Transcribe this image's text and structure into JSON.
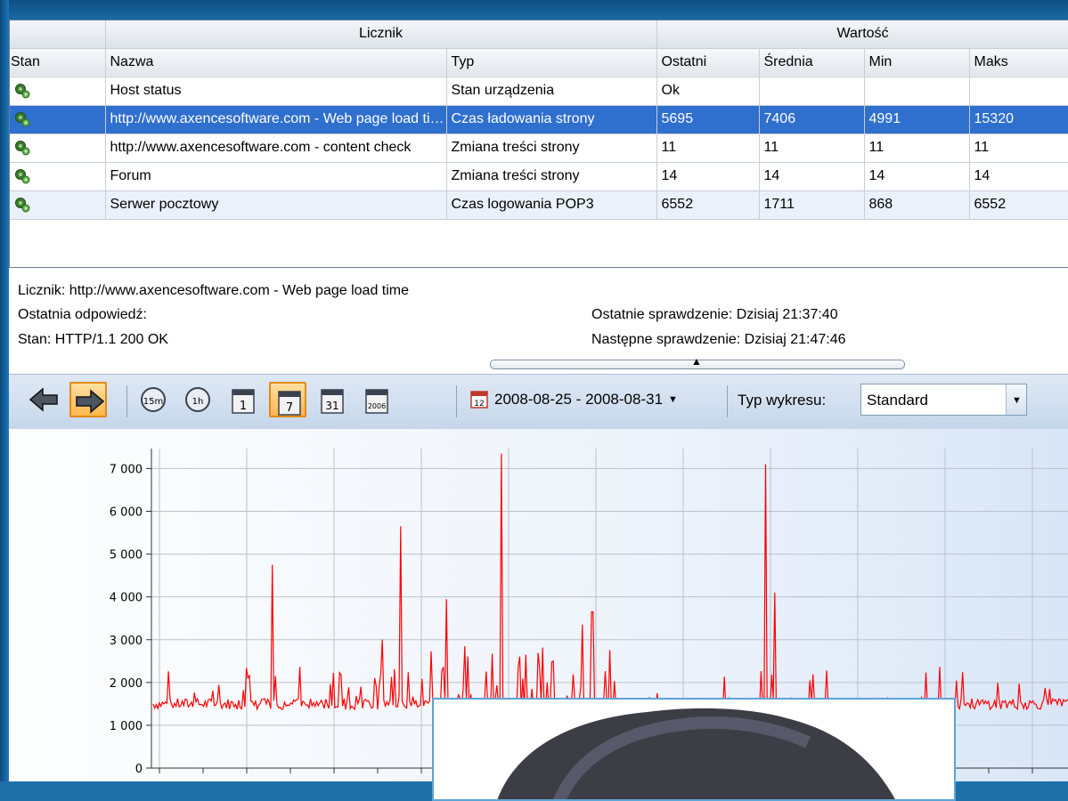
{
  "table": {
    "groups": {
      "counter": "Licznik",
      "value": "Wartość"
    },
    "columns": {
      "stan": "Stan",
      "nazwa": "Nazwa",
      "typ": "Typ",
      "ostatni": "Ostatni",
      "srednia": "Średnia",
      "min": "Min",
      "maks": "Maks"
    },
    "rows": [
      {
        "nazwa": "Host status",
        "typ": "Stan urządzenia",
        "ostatni": "Ok",
        "srednia": "",
        "min": "",
        "maks": ""
      },
      {
        "nazwa": "http://www.axencesoftware.com - Web page load time",
        "typ": "Czas ładowania strony",
        "ostatni": "5695",
        "srednia": "7406",
        "min": "4991",
        "maks": "15320"
      },
      {
        "nazwa": "http://www.axencesoftware.com - content check",
        "typ": "Zmiana treści strony",
        "ostatni": "11",
        "srednia": "11",
        "min": "11",
        "maks": "11"
      },
      {
        "nazwa": "Forum",
        "typ": "Zmiana treści strony",
        "ostatni": "14",
        "srednia": "14",
        "min": "14",
        "maks": "14"
      },
      {
        "nazwa": "Serwer pocztowy",
        "typ": "Czas logowania POP3",
        "ostatni": "6552",
        "srednia": "1711",
        "min": "868",
        "maks": "6552"
      }
    ]
  },
  "details": {
    "counter": "Licznik: http://www.axencesoftware.com - Web page load time",
    "last_response": "Ostatnia odpowiedź:",
    "status": "Stan: HTTP/1.1 200 OK",
    "last_check": "Ostatnie sprawdzenie: Dzisiaj 21:37:40",
    "next_check": "Następne sprawdzenie: Dzisiaj 21:47:46"
  },
  "toolbar": {
    "btn_15m": "15m",
    "btn_1h": "1h",
    "btn_day": "1",
    "btn_week": "7",
    "btn_month": "31",
    "btn_year": "2006",
    "calendar_day": "12",
    "date_range": "2008-08-25 - 2008-08-31",
    "chart_type_label": "Typ wykresu:",
    "chart_type_value": "Standard",
    "active_period": "7"
  },
  "chart_data": {
    "type": "line",
    "y_ticks": [
      "0",
      "1 000",
      "2 000",
      "3 000",
      "4 000",
      "5 000",
      "6 000",
      "7 000"
    ],
    "ylim": [
      0,
      7300
    ],
    "grid": true,
    "line_color": "#ff0000",
    "note": "partial view; lower-middle region hidden behind popup",
    "peaks": [
      {
        "x": 0.13,
        "y": 4750
      },
      {
        "x": 0.27,
        "y": 5650
      },
      {
        "x": 0.32,
        "y": 3950
      },
      {
        "x": 0.38,
        "y": 7350
      },
      {
        "x": 0.48,
        "y": 3650
      },
      {
        "x": 0.67,
        "y": 7100
      },
      {
        "x": 0.68,
        "y": 4100
      }
    ]
  }
}
